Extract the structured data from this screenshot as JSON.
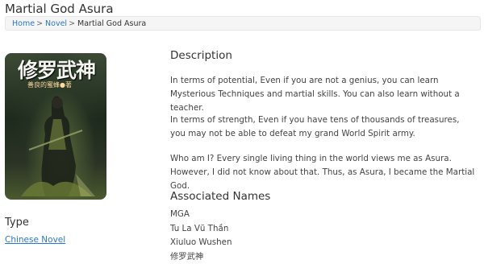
{
  "page": {
    "title": "Martial God Asura"
  },
  "breadcrumb": [
    {
      "label": "Home"
    },
    {
      "label": "Novel"
    },
    {
      "label": "Martial God Asura"
    }
  ],
  "cover": {
    "title_glyphs": "修罗武神",
    "subtitle": "善良的蜜蜂●著",
    "colors": {
      "top": "#3c4a36",
      "bottom": "#4a5a2f"
    }
  },
  "type": {
    "heading": "Type",
    "value": "Chinese Novel"
  },
  "description": {
    "heading": "Description",
    "paragraphs": [
      "In terms of potential, Even if you are not a genius, you can learn Mysterious Techniques and martial skills. You can also learn without a teacher.",
      "In terms of strength, Even if you have tens of thousands of treasures, you may not be able to defeat my grand World Spirit army.",
      "Who am I? Every single living thing in the world views me as Asura. However, I did not know about that. Thus, as Asura, I became the Martial God."
    ]
  },
  "associated_names": {
    "heading": "Associated Names",
    "items": [
      "MGA",
      "Tu La Vũ Thần",
      "Xiuluo Wushen",
      "修罗武神"
    ]
  },
  "colors": {
    "link": "#2a78c8",
    "breadcrumb_bg": "#f5f5f5"
  }
}
